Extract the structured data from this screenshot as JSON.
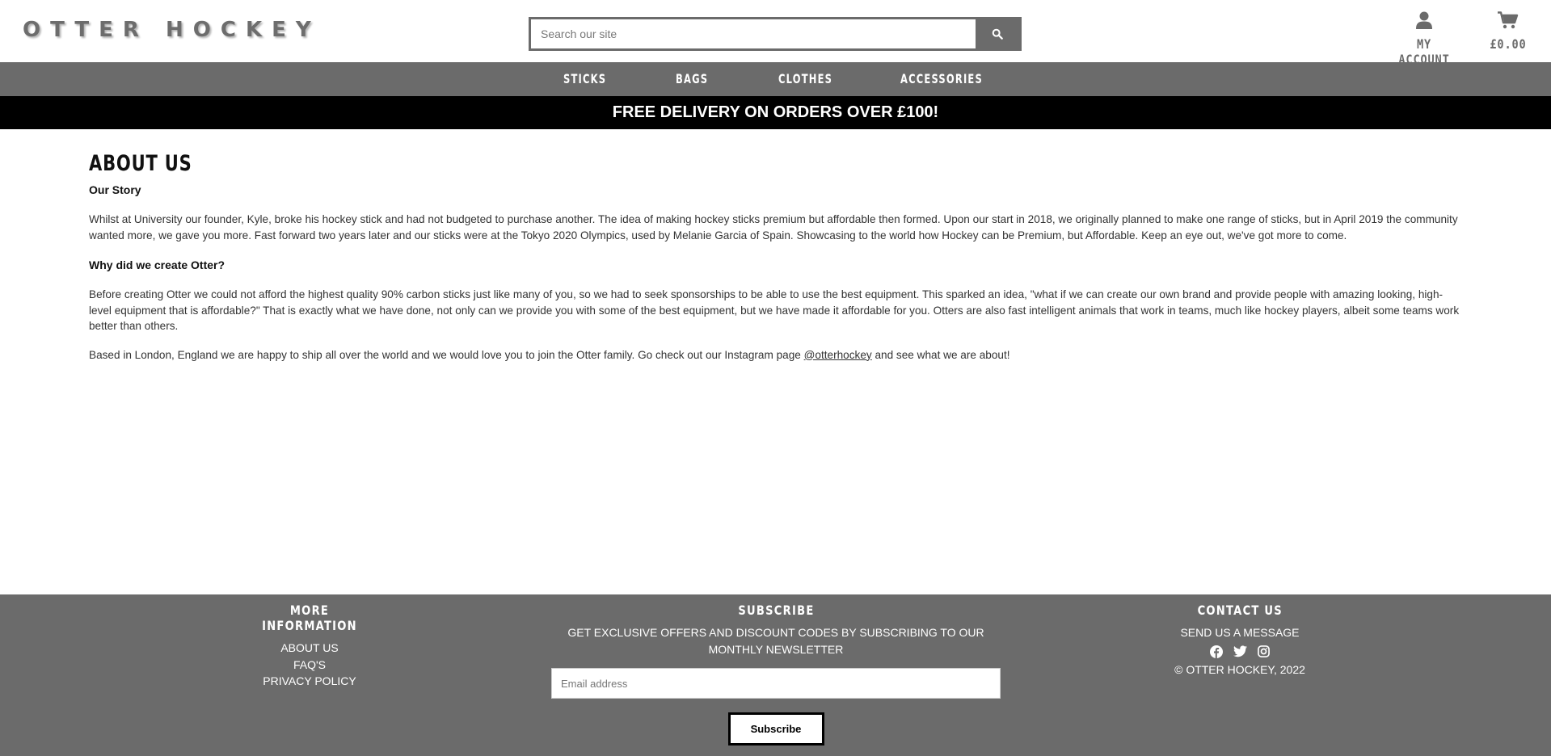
{
  "header": {
    "logo": "OTTER HOCKEY",
    "search_placeholder": "Search our site",
    "account_label": "MY ACCOUNT",
    "cart_total": "£0.00"
  },
  "nav": {
    "items": [
      "STICKS",
      "BAGS",
      "CLOTHES",
      "ACCESSORIES"
    ]
  },
  "banner": "FREE DELIVERY ON ORDERS OVER £100!",
  "main": {
    "title": "ABOUT US",
    "story_heading": "Our Story",
    "story_text": "Whilst at University our founder, Kyle, broke his hockey stick and had not budgeted to purchase another. The idea of making hockey sticks premium but affordable then formed. Upon our start in 2018, we originally planned to make one range of sticks, but in April 2019 the community wanted more, we gave you more. Fast forward two years later and our sticks were at the Tokyo 2020 Olympics, used by Melanie Garcia of Spain. Showcasing to the world how Hockey can be Premium, but Affordable. Keep an eye out, we've got more to come.",
    "why_heading": "Why did we create Otter?",
    "why_text": "Before creating Otter we could not afford the highest quality 90% carbon sticks just like many of you, so we had to seek sponsorships to be able to use the best equipment. This sparked an idea, \"what if we can create our own brand and provide people with amazing looking, high-level equipment that is affordable?\" That is exactly what we have done, not only can we provide you with some of the best equipment, but we have made it affordable for you. Otters are also fast intelligent animals that work in teams, much like hockey players, albeit some teams work better than others.",
    "based_text_before": "Based in London, England we are happy to ship all over the world and we would love you to join the Otter family. Go check out our Instagram page ",
    "instagram_handle": "@otterhockey",
    "based_text_after": " and see what we are about!"
  },
  "footer": {
    "more_info": {
      "heading": "MORE INFORMATION",
      "links": [
        "ABOUT US",
        "FAQ'S",
        "PRIVACY POLICY"
      ]
    },
    "subscribe": {
      "heading": "SUBSCRIBE",
      "text": "GET EXCLUSIVE OFFERS AND DISCOUNT CODES BY SUBSCRIBING TO OUR MONTHLY NEWSLETTER",
      "email_placeholder": "Email address",
      "button_label": "Subscribe"
    },
    "contact": {
      "heading": "CONTACT US",
      "message_link": "SEND US A MESSAGE",
      "social_icons": [
        "facebook-icon",
        "twitter-icon",
        "instagram-icon"
      ],
      "copyright": "© OTTER HOCKEY, 2022"
    }
  },
  "colors": {
    "nav_bg": "#6b6b6b",
    "banner_bg": "#000000",
    "footer_bg": "#6b6b6b",
    "logo": "#6d6d6d"
  }
}
